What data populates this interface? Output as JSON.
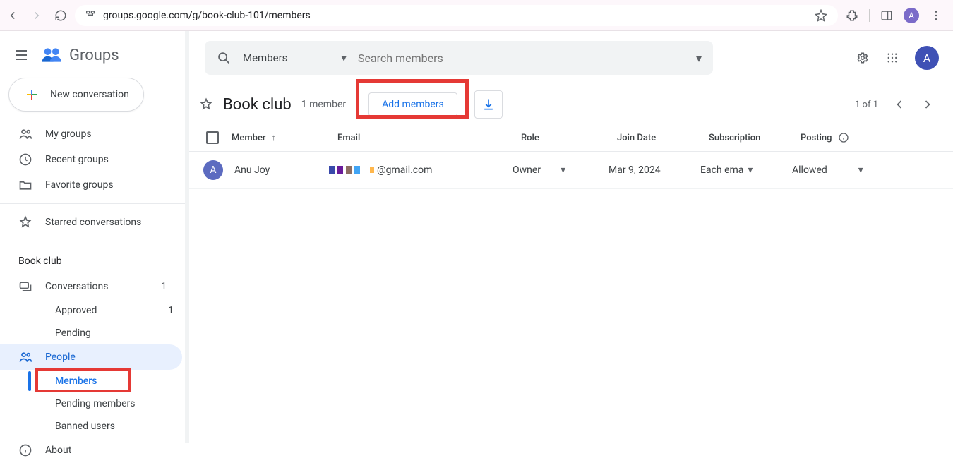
{
  "browser": {
    "url": "groups.google.com/g/book-club-101/members",
    "avatar_letter": "A"
  },
  "sidebar": {
    "app_title": "Groups",
    "new_conversation": "New conversation",
    "nav": {
      "my_groups": "My groups",
      "recent_groups": "Recent groups",
      "favorite_groups": "Favorite groups",
      "starred": "Starred conversations"
    },
    "group_section_label": "Book club",
    "group_nav": {
      "conversations": {
        "label": "Conversations",
        "count": "1"
      },
      "approved": {
        "label": "Approved",
        "count": "1"
      },
      "pending": {
        "label": "Pending"
      },
      "people": {
        "label": "People"
      },
      "members": {
        "label": "Members"
      },
      "pending_members": {
        "label": "Pending members"
      },
      "banned_users": {
        "label": "Banned users"
      },
      "about": {
        "label": "About"
      }
    }
  },
  "search": {
    "scope": "Members",
    "placeholder": "Search members"
  },
  "header": {
    "group_title": "Book club",
    "member_count": "1 member",
    "add_members": "Add members",
    "pager": "1 of 1",
    "topbar_avatar": "A"
  },
  "table": {
    "columns": {
      "member": "Member",
      "email": "Email",
      "role": "Role",
      "join_date": "Join Date",
      "subscription": "Subscription",
      "posting": "Posting"
    },
    "rows": [
      {
        "avatar_letter": "A",
        "name": "Anu Joy",
        "email_suffix": "@gmail.com",
        "role": "Owner",
        "join_date": "Mar 9, 2024",
        "subscription": "Each ema",
        "posting": "Allowed"
      }
    ]
  }
}
